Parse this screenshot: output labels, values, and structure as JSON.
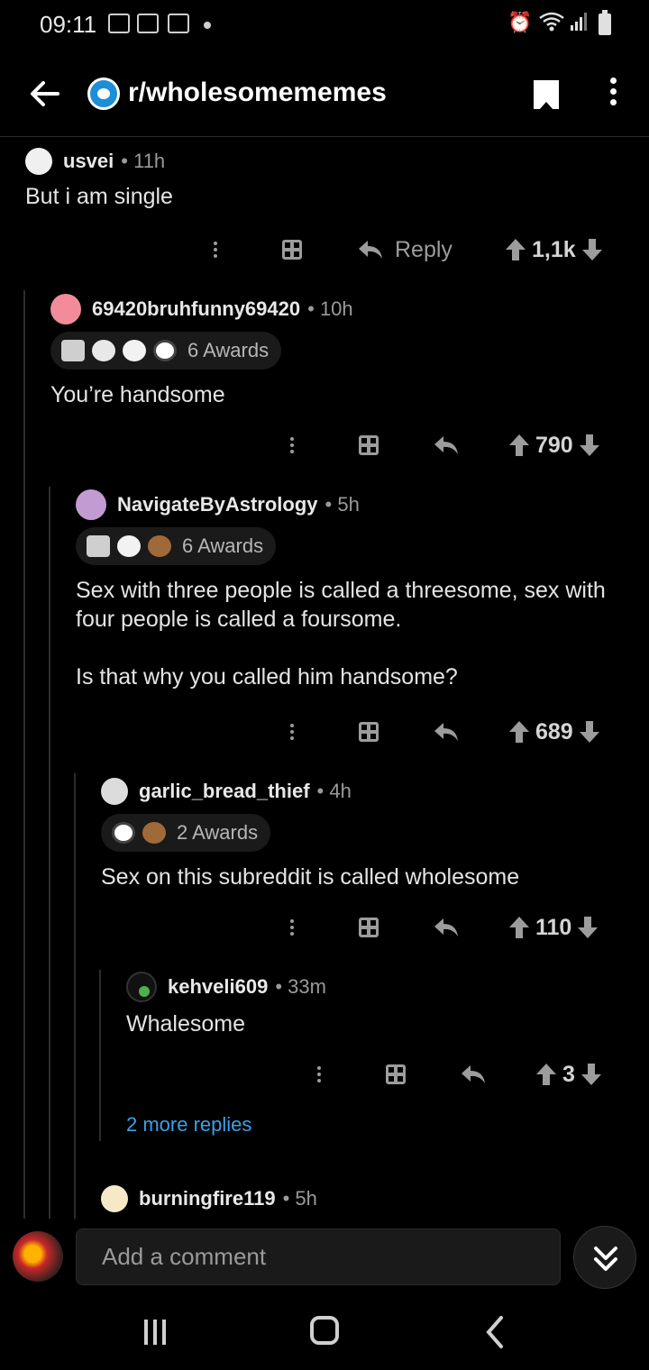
{
  "status_bar": {
    "time": "09:11"
  },
  "app_bar": {
    "subreddit": "r/wholesomememes"
  },
  "comments": [
    {
      "username": "usvei",
      "age": "11h",
      "awards_label": "",
      "body": "But i am single",
      "reply_label": "Reply",
      "score": "1,1k"
    },
    {
      "username": "69420bruhfunny69420",
      "age": "10h",
      "awards_label": "6 Awards",
      "body": "You’re handsome",
      "reply_label": "",
      "score": "790"
    },
    {
      "username": "NavigateByAstrology",
      "age": "5h",
      "awards_label": "6 Awards",
      "body": "Sex with three people is called a threesome, sex with four people is called a foursome.\n\nIs that why you called him handsome?",
      "reply_label": "",
      "score": "689"
    },
    {
      "username": "garlic_bread_thief",
      "age": "4h",
      "awards_label": "2 Awards",
      "body": "Sex on this subreddit is called wholesome",
      "reply_label": "",
      "score": "110"
    },
    {
      "username": "kehveli609",
      "age": "33m",
      "awards_label": "",
      "body": "Whalesome",
      "reply_label": "",
      "score": "3"
    },
    {
      "username": "burningfire119",
      "age": "5h"
    }
  ],
  "more_replies": "2 more replies",
  "composer": {
    "placeholder": "Add a comment"
  },
  "colors": {
    "background": "#000000",
    "link": "#3ca0e8",
    "text": "#d7dadc"
  },
  "icons": [
    "back-arrow-icon",
    "subreddit-icon",
    "bookmark-icon",
    "more-vertical-icon",
    "gift-icon",
    "reply-icon",
    "upvote-icon",
    "downvote-icon",
    "jump-down-icon"
  ]
}
